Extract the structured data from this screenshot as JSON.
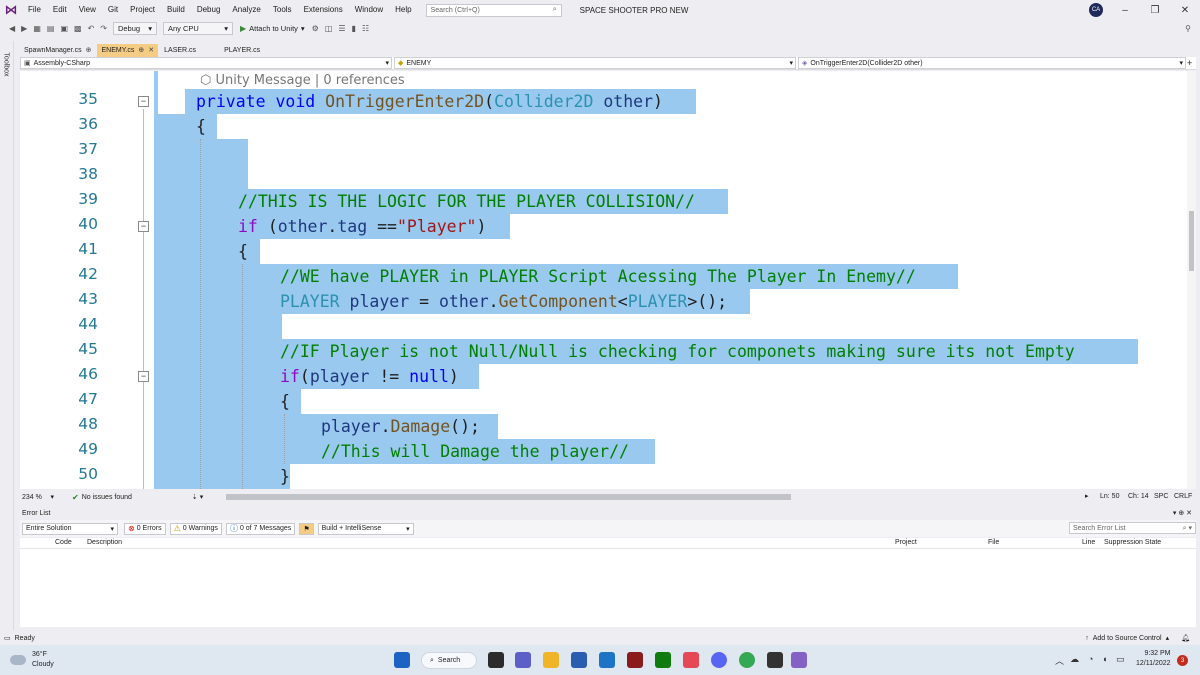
{
  "menubar": {
    "items": [
      "File",
      "Edit",
      "View",
      "Git",
      "Project",
      "Build",
      "Debug",
      "Analyze",
      "Tools",
      "Extensions",
      "Window",
      "Help"
    ],
    "search_placeholder": "Search (Ctrl+Q)",
    "solution_name": "SPACE SHOOTER PRO NEW",
    "avatar_initials": "CA"
  },
  "toolbar": {
    "config": "Debug",
    "platform": "Any CPU",
    "attach_label": "Attach to Unity"
  },
  "toolbox_label": "Toolbox",
  "tabs": [
    {
      "label": "SpawnManager.cs",
      "pin": "⊕",
      "active": false
    },
    {
      "label": "ENEMY.cs",
      "pin": "⊕",
      "active": true
    },
    {
      "label": "LASER.cs",
      "active": false
    },
    {
      "label": "PLAYER.cs",
      "active": false
    }
  ],
  "navbar": {
    "project": "Assembly-CSharp",
    "class": "ENEMY",
    "member": "OnTriggerEnter2D(Collider2D other)"
  },
  "editor": {
    "codelens": "Unity Message | 0 references",
    "lines": [
      {
        "num": "35",
        "text": "private void OnTriggerEnter2D(Collider2D other)"
      },
      {
        "num": "36",
        "text": "{"
      },
      {
        "num": "37",
        "text": ""
      },
      {
        "num": "38",
        "text": ""
      },
      {
        "num": "39",
        "text": "//THIS IS THE LOGIC FOR THE PLAYER COLLISION//"
      },
      {
        "num": "40",
        "text": "if (other.tag ==\"Player\")"
      },
      {
        "num": "41",
        "text": "{"
      },
      {
        "num": "42",
        "text": "//WE have PLAYER in PLAYER Script Acessing The Player In Enemy//"
      },
      {
        "num": "43",
        "text": "PLAYER player = other.GetComponent<PLAYER>();"
      },
      {
        "num": "44",
        "text": ""
      },
      {
        "num": "45",
        "text": "//IF Player is not Null/Null is checking for componets making sure its not Empty"
      },
      {
        "num": "46",
        "text": "if(player != null)"
      },
      {
        "num": "47",
        "text": "{"
      },
      {
        "num": "48",
        "text": "player.Damage();"
      },
      {
        "num": "49",
        "text": "//This will Damage the player//"
      },
      {
        "num": "50",
        "text": "}"
      }
    ]
  },
  "editor_status": {
    "zoom": "234 %",
    "issues": "No issues found",
    "ln": "Ln: 50",
    "ch": "Ch: 14",
    "spc": "SPC",
    "crlf": "CRLF"
  },
  "error_list": {
    "title": "Error List",
    "scope": "Entire Solution",
    "errors": "0 Errors",
    "warnings": "0 Warnings",
    "messages": "0 of 7 Messages",
    "build_filter": "Build + IntelliSense",
    "search_placeholder": "Search Error List",
    "columns": [
      "Code",
      "Description",
      "Project",
      "File",
      "Line",
      "Suppression State"
    ]
  },
  "statusbar": {
    "ready": "Ready",
    "source_control": "Add to Source Control"
  },
  "taskbar": {
    "temp": "36°F",
    "condition": "Cloudy",
    "search_label": "Search",
    "time": "9:32 PM",
    "date": "12/11/2022",
    "notifications": "3"
  },
  "colors": {
    "selection": "#99c9ef",
    "active_tab": "#f5cc84",
    "keyword": "#0000ff",
    "type": "#2b91af",
    "comment": "#008000",
    "string": "#a31515"
  }
}
